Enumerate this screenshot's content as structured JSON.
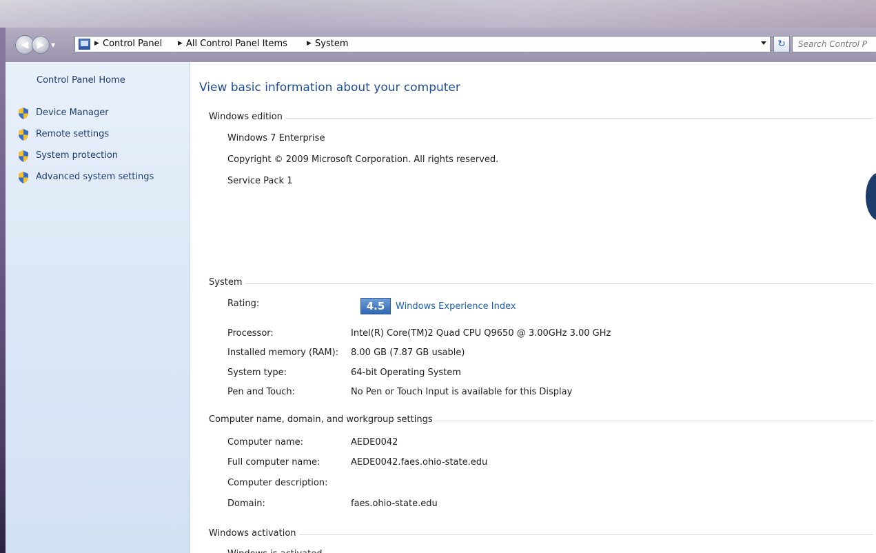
{
  "nav": {
    "back_glyph": "◀",
    "forward_glyph": "▶",
    "breadcrumbs": [
      "Control Panel",
      "All Control Panel Items",
      "System"
    ],
    "search_placeholder": "Search Control P",
    "refresh_glyph": "↻"
  },
  "sidebar": {
    "home": "Control Panel Home",
    "tasks": [
      {
        "label": "Device Manager",
        "icon": "uac-shield-icon"
      },
      {
        "label": "Remote settings",
        "icon": "uac-shield-icon"
      },
      {
        "label": "System protection",
        "icon": "uac-shield-icon"
      },
      {
        "label": "Advanced system settings",
        "icon": "uac-shield-icon"
      }
    ]
  },
  "main": {
    "title": "View basic information about your computer",
    "edition": {
      "heading": "Windows edition",
      "name": "Windows 7 Enterprise",
      "copyright": "Copyright © 2009 Microsoft Corporation.  All rights reserved.",
      "service_pack": "Service Pack 1"
    },
    "system": {
      "heading": "System",
      "rating_label": "Rating:",
      "rating_score": "4.5",
      "rating_link": "Windows Experience Index",
      "rows": [
        {
          "label": "Processor:",
          "value": "Intel(R) Core(TM)2 Quad CPU    Q9650  @ 3.00GHz   3.00 GHz"
        },
        {
          "label": "Installed memory (RAM):",
          "value": "8.00 GB (7.87 GB usable)"
        },
        {
          "label": "System type:",
          "value": "64-bit Operating System"
        },
        {
          "label": "Pen and Touch:",
          "value": "No Pen or Touch Input is available for this Display"
        }
      ]
    },
    "computer": {
      "heading": "Computer name, domain, and workgroup settings",
      "rows": [
        {
          "label": "Computer name:",
          "value": "AEDE0042"
        },
        {
          "label": "Full computer name:",
          "value": "AEDE0042.faes.ohio-state.edu"
        },
        {
          "label": "Computer description:",
          "value": ""
        },
        {
          "label": "Domain:",
          "value": "faes.ohio-state.edu"
        }
      ]
    },
    "activation": {
      "heading": "Windows activation",
      "status": "Windows is activated"
    }
  },
  "colors": {
    "link": "#1e5fb4",
    "title": "#1e4d9a",
    "sidebar_bg": "#dbe7f6",
    "rating_badge": "#2e66b4"
  }
}
